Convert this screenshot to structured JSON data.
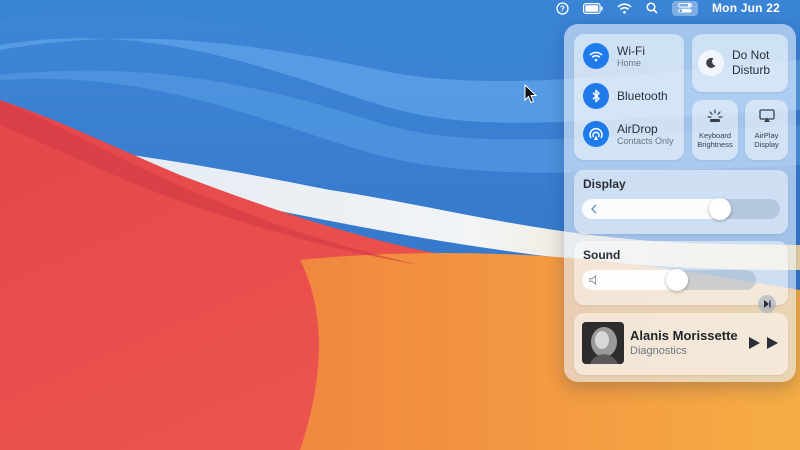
{
  "menubar": {
    "clock": "Mon Jun 22",
    "icons": [
      "help-icon",
      "battery-icon",
      "wifi-icon",
      "search-icon",
      "control-center-icon"
    ]
  },
  "control_center": {
    "wifi": {
      "label": "Wi-Fi",
      "sub": "Home"
    },
    "bluetooth": {
      "label": "Bluetooth"
    },
    "airdrop": {
      "label": "AirDrop",
      "sub": "Contacts Only"
    },
    "dnd": {
      "line1": "Do Not",
      "line2": "Disturb"
    },
    "keyboard": {
      "line1": "Keyboard",
      "line2": "Brightness"
    },
    "airplay": {
      "line1": "AirPlay",
      "line2": "Display"
    },
    "display": {
      "title": "Display",
      "level": 0.72
    },
    "sound": {
      "title": "Sound",
      "level": 0.55
    },
    "now_playing": {
      "title": "Alanis Morissette",
      "artist": "Diagnostics"
    }
  },
  "colors": {
    "accent": "#1f7aec"
  }
}
